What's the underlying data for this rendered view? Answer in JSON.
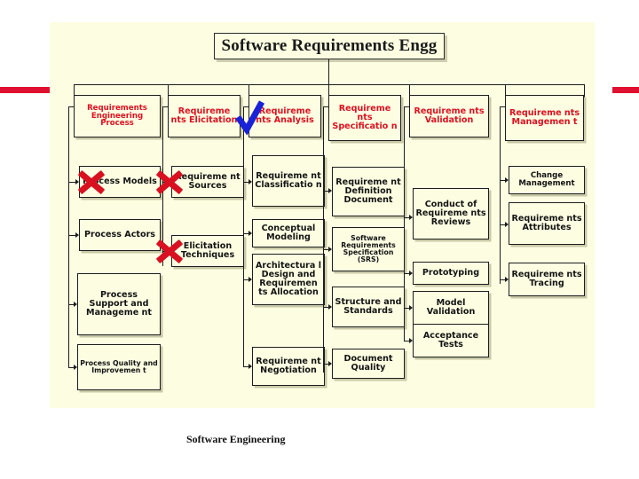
{
  "slide": {
    "title": "Software Requirements Engg",
    "footer": "Software Engineering",
    "accent_red": "#E01020",
    "bar_red": "#E01030",
    "panel_bg": "#FDFDE2",
    "mark_red": "#D81020",
    "check_blue": "#1A22D8"
  },
  "columns": [
    {
      "head": "Requirements Engineering Process",
      "children": [
        "Process Models",
        "Process Actors",
        "Process Support and Manageme nt",
        "Process Quality and Improvemen t"
      ]
    },
    {
      "head": "Requireme nts Elicitation",
      "children": [
        "Requireme nt Sources",
        "Elicitation Techniques"
      ]
    },
    {
      "head": "Requireme nts Analysis",
      "children": [
        "Requireme nt Classificatio n",
        "Conceptual Modeling",
        "Architectura l Design and Requiremen ts Allocation",
        "Requireme nt Negotiation"
      ]
    },
    {
      "head": "Requireme nts Specificatio n",
      "children": [
        "Requireme nt Definition Document",
        "Software Requirements Specification (SRS)",
        "Structure and Standards",
        "Document Quality"
      ]
    },
    {
      "head": "Requireme nts Validation",
      "children": [
        "Conduct of Requireme nts Reviews",
        "Prototyping",
        "Model Validation",
        "Acceptance Tests"
      ]
    },
    {
      "head": "Requireme nts Managemen t",
      "children": [
        "Change Management",
        "Requireme nts Attributes",
        "Requireme nts Tracing"
      ]
    }
  ],
  "annotations": {
    "cross_marks": [
      "Process Models",
      "Requirement Sources",
      "Elicitation Techniques"
    ],
    "check_marks": [
      "Requirements Analysis"
    ]
  }
}
